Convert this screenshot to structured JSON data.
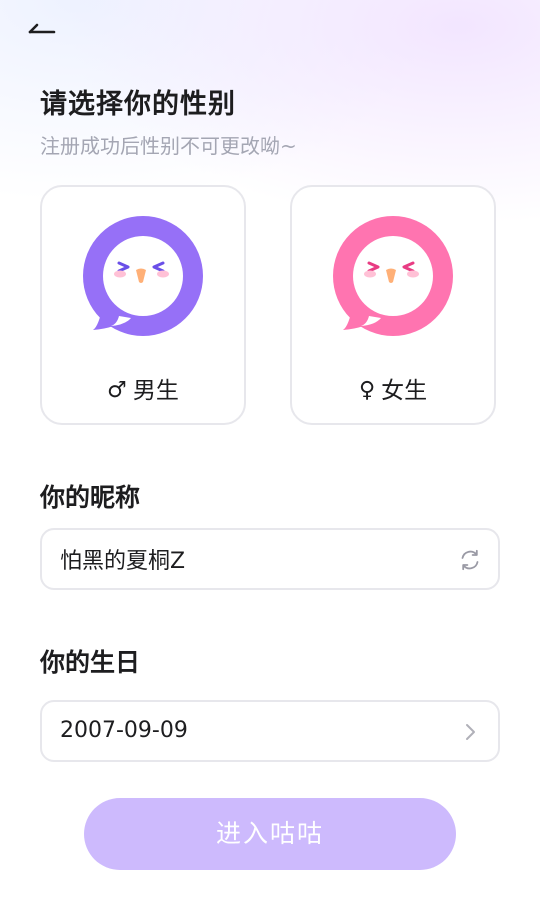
{
  "header": {
    "title": "请选择你的性别",
    "subtitle": "注册成功后性别不可更改呦~"
  },
  "gender": {
    "options": [
      {
        "symbol": "♂",
        "label": "男生",
        "accent": "#9670f7"
      },
      {
        "symbol": "♀",
        "label": "女生",
        "accent": "#ff74b0"
      }
    ]
  },
  "nickname": {
    "label": "你的昵称",
    "value": "怕黑的夏桐Z"
  },
  "birthday": {
    "label": "你的生日",
    "value": "2007-09-09"
  },
  "submit": {
    "label": "进入咕咕",
    "color": "#cdbafd"
  },
  "icons": {
    "back": "back-arrow-icon",
    "refresh": "refresh-icon",
    "chevron": "chevron-right-icon"
  }
}
